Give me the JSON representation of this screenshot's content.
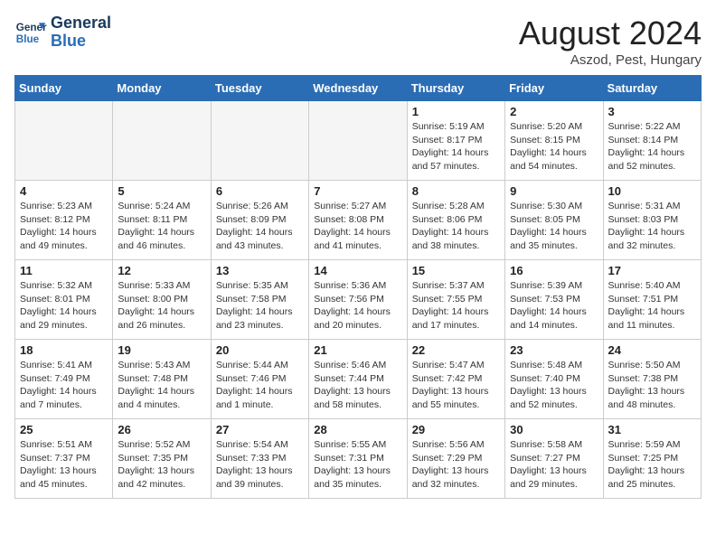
{
  "header": {
    "logo_line1": "General",
    "logo_line2": "Blue",
    "month_title": "August 2024",
    "location": "Aszod, Pest, Hungary"
  },
  "days_of_week": [
    "Sunday",
    "Monday",
    "Tuesday",
    "Wednesday",
    "Thursday",
    "Friday",
    "Saturday"
  ],
  "weeks": [
    [
      {
        "day": "",
        "info": ""
      },
      {
        "day": "",
        "info": ""
      },
      {
        "day": "",
        "info": ""
      },
      {
        "day": "",
        "info": ""
      },
      {
        "day": "1",
        "info": "Sunrise: 5:19 AM\nSunset: 8:17 PM\nDaylight: 14 hours\nand 57 minutes."
      },
      {
        "day": "2",
        "info": "Sunrise: 5:20 AM\nSunset: 8:15 PM\nDaylight: 14 hours\nand 54 minutes."
      },
      {
        "day": "3",
        "info": "Sunrise: 5:22 AM\nSunset: 8:14 PM\nDaylight: 14 hours\nand 52 minutes."
      }
    ],
    [
      {
        "day": "4",
        "info": "Sunrise: 5:23 AM\nSunset: 8:12 PM\nDaylight: 14 hours\nand 49 minutes."
      },
      {
        "day": "5",
        "info": "Sunrise: 5:24 AM\nSunset: 8:11 PM\nDaylight: 14 hours\nand 46 minutes."
      },
      {
        "day": "6",
        "info": "Sunrise: 5:26 AM\nSunset: 8:09 PM\nDaylight: 14 hours\nand 43 minutes."
      },
      {
        "day": "7",
        "info": "Sunrise: 5:27 AM\nSunset: 8:08 PM\nDaylight: 14 hours\nand 41 minutes."
      },
      {
        "day": "8",
        "info": "Sunrise: 5:28 AM\nSunset: 8:06 PM\nDaylight: 14 hours\nand 38 minutes."
      },
      {
        "day": "9",
        "info": "Sunrise: 5:30 AM\nSunset: 8:05 PM\nDaylight: 14 hours\nand 35 minutes."
      },
      {
        "day": "10",
        "info": "Sunrise: 5:31 AM\nSunset: 8:03 PM\nDaylight: 14 hours\nand 32 minutes."
      }
    ],
    [
      {
        "day": "11",
        "info": "Sunrise: 5:32 AM\nSunset: 8:01 PM\nDaylight: 14 hours\nand 29 minutes."
      },
      {
        "day": "12",
        "info": "Sunrise: 5:33 AM\nSunset: 8:00 PM\nDaylight: 14 hours\nand 26 minutes."
      },
      {
        "day": "13",
        "info": "Sunrise: 5:35 AM\nSunset: 7:58 PM\nDaylight: 14 hours\nand 23 minutes."
      },
      {
        "day": "14",
        "info": "Sunrise: 5:36 AM\nSunset: 7:56 PM\nDaylight: 14 hours\nand 20 minutes."
      },
      {
        "day": "15",
        "info": "Sunrise: 5:37 AM\nSunset: 7:55 PM\nDaylight: 14 hours\nand 17 minutes."
      },
      {
        "day": "16",
        "info": "Sunrise: 5:39 AM\nSunset: 7:53 PM\nDaylight: 14 hours\nand 14 minutes."
      },
      {
        "day": "17",
        "info": "Sunrise: 5:40 AM\nSunset: 7:51 PM\nDaylight: 14 hours\nand 11 minutes."
      }
    ],
    [
      {
        "day": "18",
        "info": "Sunrise: 5:41 AM\nSunset: 7:49 PM\nDaylight: 14 hours\nand 7 minutes."
      },
      {
        "day": "19",
        "info": "Sunrise: 5:43 AM\nSunset: 7:48 PM\nDaylight: 14 hours\nand 4 minutes."
      },
      {
        "day": "20",
        "info": "Sunrise: 5:44 AM\nSunset: 7:46 PM\nDaylight: 14 hours\nand 1 minute."
      },
      {
        "day": "21",
        "info": "Sunrise: 5:46 AM\nSunset: 7:44 PM\nDaylight: 13 hours\nand 58 minutes."
      },
      {
        "day": "22",
        "info": "Sunrise: 5:47 AM\nSunset: 7:42 PM\nDaylight: 13 hours\nand 55 minutes."
      },
      {
        "day": "23",
        "info": "Sunrise: 5:48 AM\nSunset: 7:40 PM\nDaylight: 13 hours\nand 52 minutes."
      },
      {
        "day": "24",
        "info": "Sunrise: 5:50 AM\nSunset: 7:38 PM\nDaylight: 13 hours\nand 48 minutes."
      }
    ],
    [
      {
        "day": "25",
        "info": "Sunrise: 5:51 AM\nSunset: 7:37 PM\nDaylight: 13 hours\nand 45 minutes."
      },
      {
        "day": "26",
        "info": "Sunrise: 5:52 AM\nSunset: 7:35 PM\nDaylight: 13 hours\nand 42 minutes."
      },
      {
        "day": "27",
        "info": "Sunrise: 5:54 AM\nSunset: 7:33 PM\nDaylight: 13 hours\nand 39 minutes."
      },
      {
        "day": "28",
        "info": "Sunrise: 5:55 AM\nSunset: 7:31 PM\nDaylight: 13 hours\nand 35 minutes."
      },
      {
        "day": "29",
        "info": "Sunrise: 5:56 AM\nSunset: 7:29 PM\nDaylight: 13 hours\nand 32 minutes."
      },
      {
        "day": "30",
        "info": "Sunrise: 5:58 AM\nSunset: 7:27 PM\nDaylight: 13 hours\nand 29 minutes."
      },
      {
        "day": "31",
        "info": "Sunrise: 5:59 AM\nSunset: 7:25 PM\nDaylight: 13 hours\nand 25 minutes."
      }
    ]
  ]
}
